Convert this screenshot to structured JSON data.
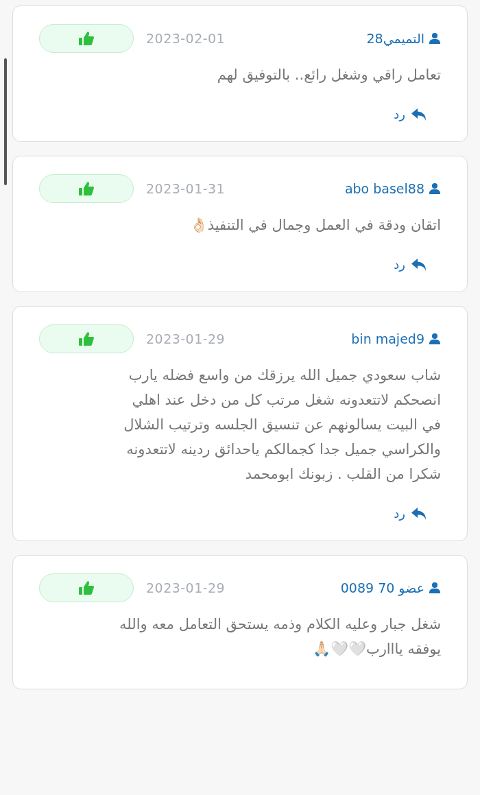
{
  "reviews": [
    {
      "user": "التميمي28",
      "date": "2023-02-01",
      "text": "تعامل راقي وشغل رائع.. بالتوفيق لهم",
      "reply": "رد"
    },
    {
      "user": "abo basel88",
      "date": "2023-01-31",
      "text": "اتقان ودقة في العمل وجمال في التنفيذ👌🏻",
      "reply": "رد"
    },
    {
      "user": "bin majed9",
      "date": "2023-01-29",
      "text": "شاب سعودي جميل الله يرزقك من واسع فضله يارب\nانصحكم لاتتعدونه شغل مرتب كل من دخل عند اهلي\nفي البيت يسالونهم عن تنسيق الجلسه وترتيب الشلال\nوالكراسي جميل جدا كجمالكم ياحدائق ردينه لاتتعدونه\nشكرا من القلب . زبونك ابومحمد",
      "reply": "رد"
    },
    {
      "user": "عضو 70 0089",
      "date": "2023-01-29",
      "text": "شغل جبار وعليه الكلام وذمه يستحق التعامل معه والله\nيوفقه يااارب🤍🤍🙏🏻"
    }
  ]
}
